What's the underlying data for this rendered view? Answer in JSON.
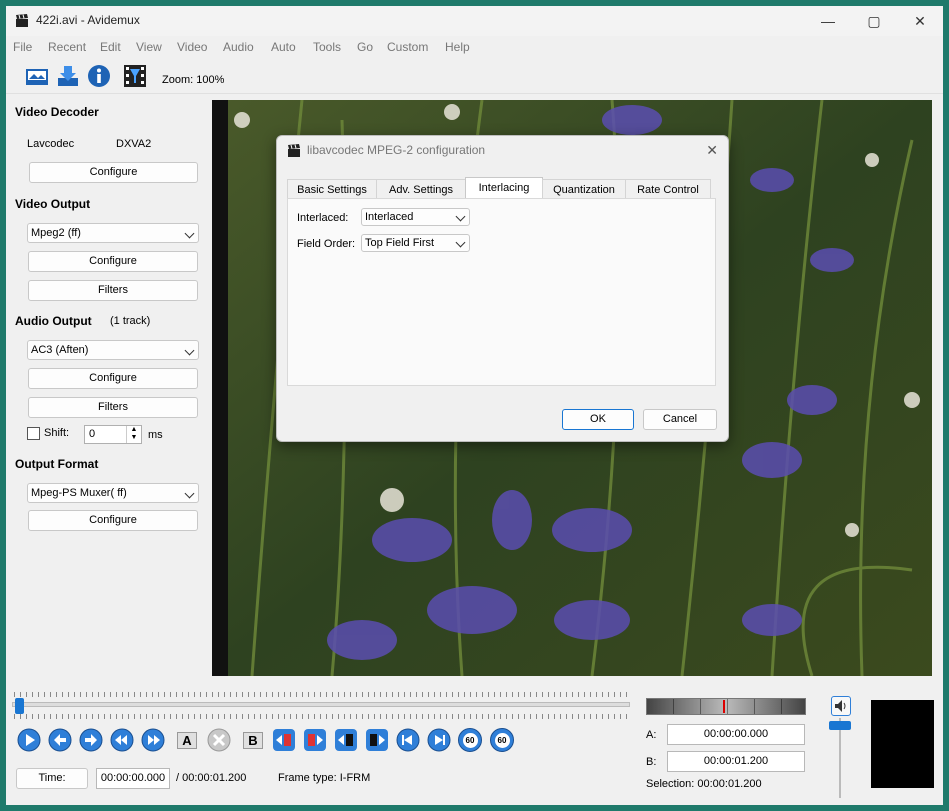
{
  "window": {
    "title": "422i.avi - Avidemux",
    "minimize": "—",
    "maximize": "▢",
    "close": "✕"
  },
  "menu": [
    "File",
    "Recent",
    "Edit",
    "View",
    "Video",
    "Audio",
    "Auto",
    "Tools",
    "Go",
    "Custom",
    "Help"
  ],
  "toolbar": {
    "zoom": "Zoom: 100%"
  },
  "video_decoder": {
    "title": "Video Decoder",
    "codec": "Lavcodec",
    "accel": "DXVA2",
    "configure": "Configure"
  },
  "video_output": {
    "title": "Video Output",
    "codec": "Mpeg2 (ff)",
    "configure": "Configure",
    "filters": "Filters"
  },
  "audio_output": {
    "title": "Audio Output",
    "tracks": "(1 track)",
    "codec": "AC3 (Aften)",
    "configure": "Configure",
    "filters": "Filters",
    "shift_label": "Shift:",
    "shift_value": "0",
    "shift_unit": "ms"
  },
  "output_format": {
    "title": "Output Format",
    "muxer": "Mpeg-PS Muxer( ff)",
    "configure": "Configure"
  },
  "dialog": {
    "title": "libavcodec MPEG-2 configuration",
    "tabs": [
      "Basic Settings",
      "Adv. Settings",
      "Interlacing",
      "Quantization",
      "Rate Control"
    ],
    "active_tab": "Interlacing",
    "interlaced_label": "Interlaced:",
    "interlaced_value": "Interlaced",
    "field_order_label": "Field Order:",
    "field_order_value": "Top Field First",
    "ok": "OK",
    "cancel": "Cancel",
    "close": "✕"
  },
  "bottom": {
    "time_button": "Time:",
    "current_time": "00:00:00.000",
    "total_time": "/ 00:00:01.200",
    "frame_type": "Frame type:  I-FRM",
    "a_label": "A:",
    "a_value": "00:00:00.000",
    "b_label": "B:",
    "b_value": "00:00:01.200",
    "selection": "Selection: 00:00:01.200",
    "go60a": "60",
    "go60b": "60",
    "mark_a": "A",
    "mark_b": "B"
  },
  "colors": {
    "accent": "#1976d2",
    "control_blue": "#2f7fd8",
    "teal_border": "#1f7a6b"
  }
}
